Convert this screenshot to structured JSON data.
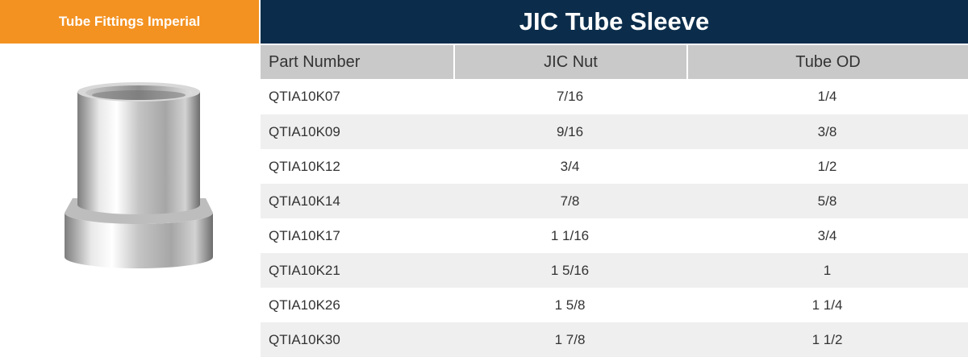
{
  "header": {
    "category": "Tube Fittings Imperial",
    "title": "JIC Tube Sleeve"
  },
  "colors": {
    "category_bg": "#f39221",
    "title_bg": "#0b2d4b",
    "table_header_bg": "#c9c9c9",
    "row_alt_bg": "#efefef",
    "text": "#333333"
  },
  "table": {
    "columns": [
      "Part Number",
      "JIC Nut",
      "Tube OD"
    ],
    "rows": [
      [
        "QTIA10K07",
        "7/16",
        "1/4"
      ],
      [
        "QTIA10K09",
        "9/16",
        "3/8"
      ],
      [
        "QTIA10K12",
        "3/4",
        "1/2"
      ],
      [
        "QTIA10K14",
        "7/8",
        "5/8"
      ],
      [
        "QTIA10K17",
        "1 1/16",
        "3/4"
      ],
      [
        "QTIA10K21",
        "1 5/16",
        "1"
      ],
      [
        "QTIA10K26",
        "1 5/8",
        "1 1/4"
      ],
      [
        "QTIA10K30",
        "1 7/8",
        "1 1/2"
      ]
    ]
  },
  "image": {
    "icon": "tube-sleeve-product-icon"
  }
}
